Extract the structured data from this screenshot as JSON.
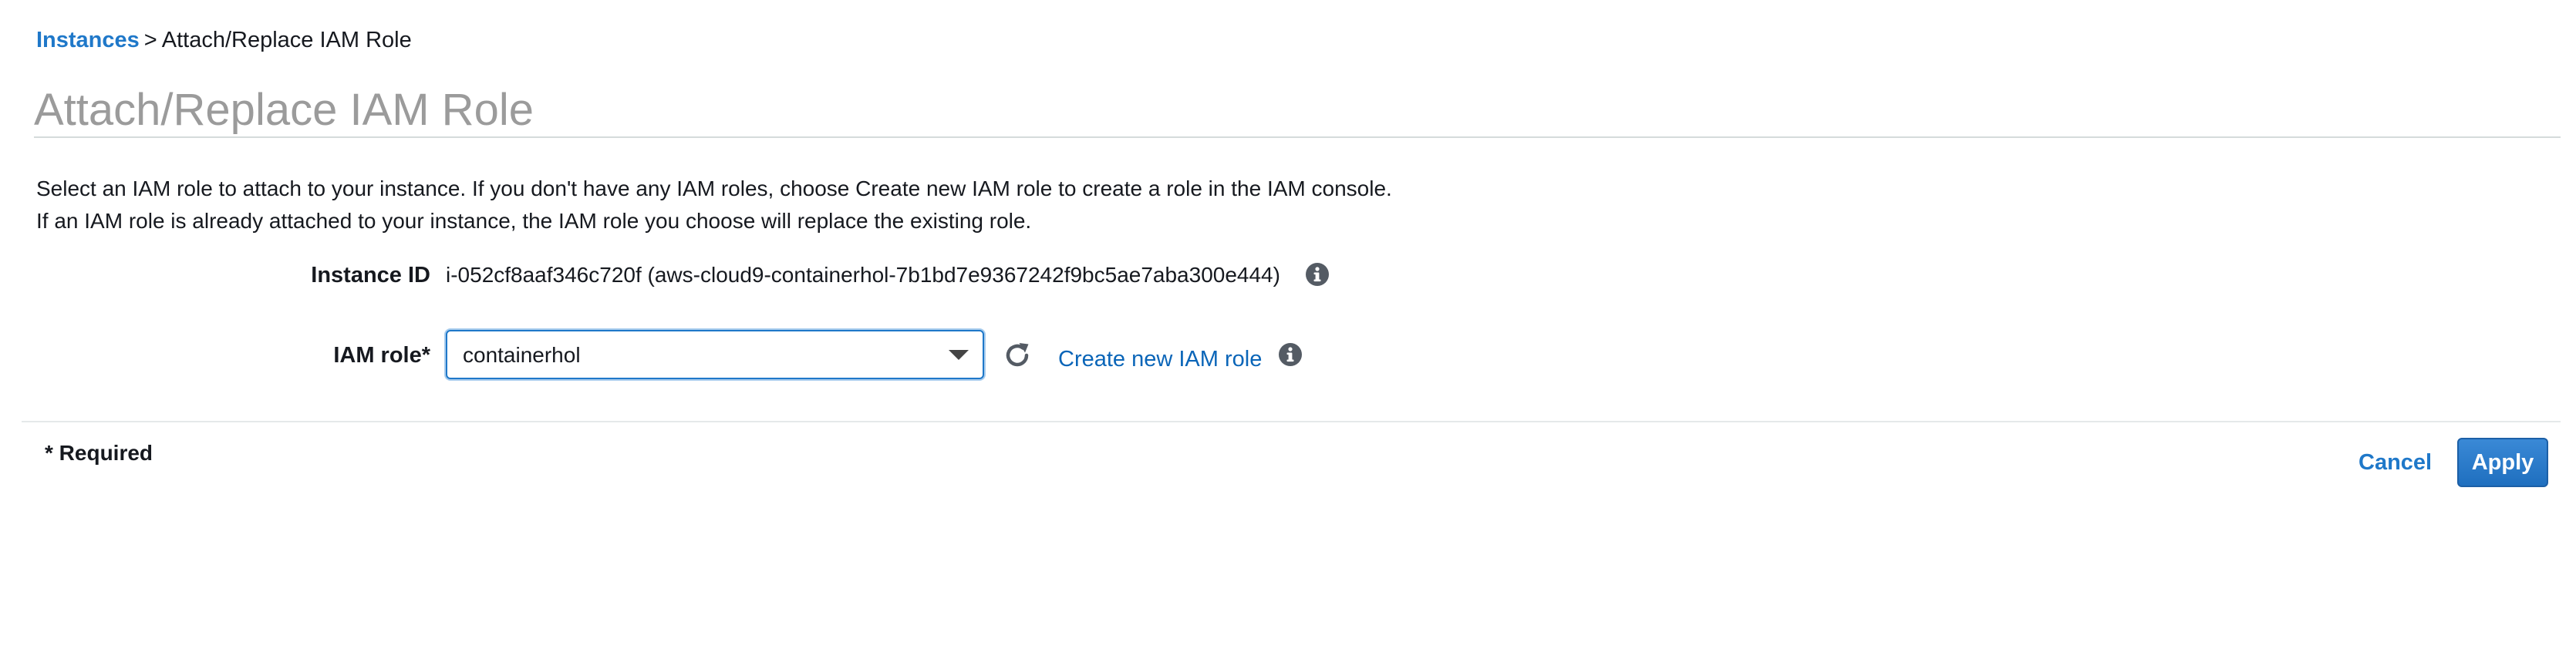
{
  "breadcrumb": {
    "link_label": "Instances",
    "separator": ">",
    "current": "Attach/Replace IAM Role"
  },
  "page": {
    "title": "Attach/Replace IAM Role",
    "description_line1": "Select an IAM role to attach to your instance. If you don't have any IAM roles, choose Create new IAM role to create a role in the IAM console.",
    "description_line2": "If an IAM role is already attached to your instance, the IAM role you choose will replace the existing role."
  },
  "form": {
    "instance_id_label": "Instance ID",
    "instance_id_value": "i-052cf8aaf346c720f (aws-cloud9-containerhol-7b1bd7e9367242f9bc5ae7aba300e444)",
    "iam_role_label": "IAM role*",
    "iam_role_selected": "containerhol",
    "create_role_link": "Create new IAM role"
  },
  "footer": {
    "required_note": "* Required",
    "cancel_label": "Cancel",
    "apply_label": "Apply"
  },
  "icons": {
    "info": "info-icon",
    "refresh": "refresh-icon",
    "dropdown": "chevron-down-icon"
  },
  "colors": {
    "link": "#1f78c9",
    "title": "#9b9b9b",
    "primary_button": "#1f6fbf",
    "focus_border": "#1f78c9"
  }
}
